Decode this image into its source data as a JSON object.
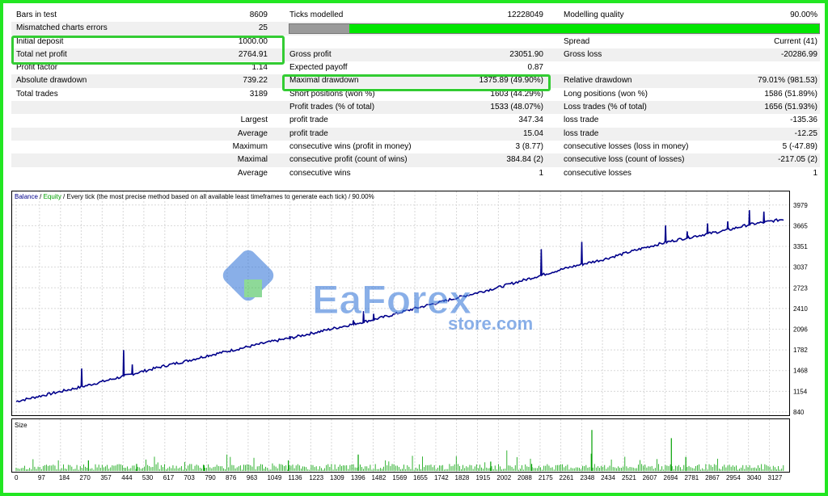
{
  "stats": {
    "rows": [
      {
        "l1": "Bars in test",
        "v1": "8609",
        "l2": "Ticks modelled",
        "v2": "12228049",
        "l3": "Modelling quality",
        "v3": "90.00%"
      },
      {
        "l1": "Mismatched charts errors",
        "v1": "25",
        "l2": "",
        "v2": "",
        "l3": "",
        "v3": "",
        "quality_bar": true
      },
      {
        "l1": "Initial deposit",
        "v1": "1000.00",
        "l2": "",
        "v2": "",
        "l3": "Spread",
        "v3": "Current (41)"
      },
      {
        "l1": "Total net profit",
        "v1": "2764.91",
        "l2": "Gross profit",
        "v2": "23051.90",
        "l3": "Gross loss",
        "v3": "-20286.99"
      },
      {
        "l1": "Profit factor",
        "v1": "1.14",
        "l2": "Expected payoff",
        "v2": "0.87",
        "l3": "",
        "v3": ""
      },
      {
        "l1": "Absolute drawdown",
        "v1": "739.22",
        "l2": "Maximal drawdown",
        "v2": "1375.89 (49.90%)",
        "l3": "Relative drawdown",
        "v3": "79.01% (981.53)"
      },
      {
        "l1": "Total trades",
        "v1": "3189",
        "l2": "Short positions (won %)",
        "v2": "1603 (44.29%)",
        "l3": "Long positions (won %)",
        "v3": "1586 (51.89%)"
      },
      {
        "l1": "",
        "v1": "",
        "l2": "Profit trades (% of total)",
        "v2": "1533 (48.07%)",
        "l3": "Loss trades (% of total)",
        "v3": "1656 (51.93%)"
      },
      {
        "right_label": "Largest",
        "l2": "profit trade",
        "v2": "347.34",
        "l3": "loss trade",
        "v3": "-135.36"
      },
      {
        "right_label": "Average",
        "l2": "profit trade",
        "v2": "15.04",
        "l3": "loss trade",
        "v3": "-12.25"
      },
      {
        "right_label": "Maximum",
        "l2": "consecutive wins (profit in money)",
        "v2": "3 (8.77)",
        "l3": "consecutive losses (loss in money)",
        "v3": "5 (-47.89)"
      },
      {
        "right_label": "Maximal",
        "l2": "consecutive profit (count of wins)",
        "v2": "384.84 (2)",
        "l3": "consecutive loss (count of losses)",
        "v3": "-217.05 (2)"
      },
      {
        "right_label": "Average",
        "l2": "consecutive wins",
        "v2": "1",
        "l3": "consecutive losses",
        "v3": "1"
      }
    ],
    "quality_fraction": 0.9
  },
  "watermark": {
    "brand": "EaForex",
    "sub": "store.com"
  },
  "colors": {
    "balance": "#00008b",
    "equity": "#00a000",
    "border": "#22e622",
    "highlight": "#33cc33",
    "quality_bar": "#00e600"
  },
  "chart_data": {
    "type": "line",
    "legend": {
      "balance": "Balance",
      "sep": " / ",
      "equity": "Equity",
      "desc": " / Every tick (the most precise method based on all available least timeframes to generate each tick) / 90.00%"
    },
    "yticks": [
      840,
      1154,
      1468,
      1782,
      2096,
      2410,
      2723,
      3037,
      3351,
      3665,
      3979
    ],
    "ylim": [
      840,
      4050
    ],
    "xticks": [
      0,
      97,
      184,
      270,
      357,
      444,
      530,
      617,
      703,
      790,
      876,
      963,
      1049,
      1136,
      1223,
      1309,
      1396,
      1482,
      1569,
      1655,
      1742,
      1828,
      1915,
      2002,
      2088,
      2175,
      2261,
      2348,
      2434,
      2521,
      2607,
      2694,
      2781,
      2867,
      2954,
      3040,
      3127
    ],
    "xlim": [
      0,
      3189
    ],
    "balance_points": [
      [
        0,
        1000
      ],
      [
        97,
        1080
      ],
      [
        184,
        1150
      ],
      [
        270,
        1220
      ],
      [
        357,
        1300
      ],
      [
        444,
        1380
      ],
      [
        530,
        1460
      ],
      [
        617,
        1540
      ],
      [
        703,
        1610
      ],
      [
        790,
        1690
      ],
      [
        876,
        1760
      ],
      [
        963,
        1830
      ],
      [
        1049,
        1900
      ],
      [
        1136,
        1960
      ],
      [
        1223,
        2030
      ],
      [
        1309,
        2100
      ],
      [
        1396,
        2170
      ],
      [
        1482,
        2240
      ],
      [
        1569,
        2320
      ],
      [
        1655,
        2410
      ],
      [
        1742,
        2490
      ],
      [
        1828,
        2570
      ],
      [
        1915,
        2650
      ],
      [
        2002,
        2730
      ],
      [
        2088,
        2820
      ],
      [
        2175,
        2910
      ],
      [
        2261,
        3000
      ],
      [
        2348,
        3080
      ],
      [
        2434,
        3150
      ],
      [
        2521,
        3240
      ],
      [
        2607,
        3330
      ],
      [
        2694,
        3410
      ],
      [
        2781,
        3480
      ],
      [
        2867,
        3540
      ],
      [
        2954,
        3600
      ],
      [
        3040,
        3680
      ],
      [
        3127,
        3730
      ],
      [
        3189,
        3765
      ]
    ],
    "spikes": [
      [
        270,
        1500
      ],
      [
        444,
        1780
      ],
      [
        480,
        1560
      ],
      [
        790,
        1700
      ],
      [
        1136,
        1990
      ],
      [
        1396,
        2230
      ],
      [
        1440,
        2370
      ],
      [
        1482,
        2330
      ],
      [
        2175,
        3310
      ],
      [
        2348,
        3420
      ],
      [
        2694,
        3670
      ],
      [
        2781,
        3580
      ],
      [
        2867,
        3700
      ],
      [
        2954,
        3730
      ],
      [
        3040,
        3900
      ],
      [
        3100,
        3880
      ]
    ],
    "size_panel_label": "Size",
    "size_bars": [
      [
        300,
        9
      ],
      [
        500,
        6
      ],
      [
        780,
        5
      ],
      [
        1130,
        9
      ],
      [
        1420,
        14
      ],
      [
        1970,
        8
      ],
      [
        2140,
        6
      ],
      [
        2390,
        35
      ],
      [
        2720,
        28
      ],
      [
        2780,
        12
      ]
    ]
  }
}
